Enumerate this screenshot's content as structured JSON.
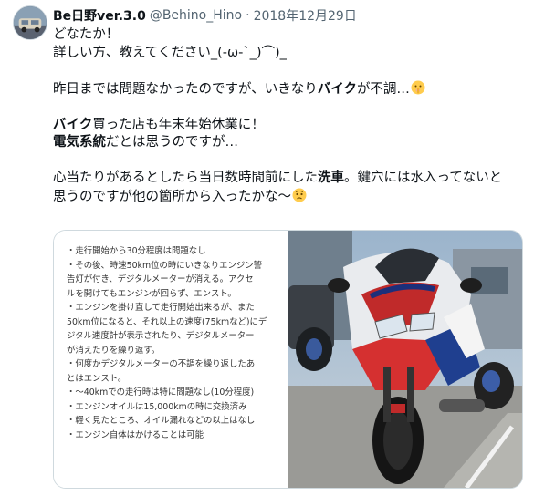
{
  "author": {
    "name": "Be日野ver.3.0",
    "handle": "@Behino_Hino",
    "separator": "·",
    "date": "2018年12月29日"
  },
  "tweet": {
    "line1": "どなたか！",
    "line2": "詳しい方、教えてください_(-ω-`_)⌒)_",
    "line3_a": "昨日までは問題なかったのですが、いきなり",
    "line3_b": "バイク",
    "line3_c": "が不調…",
    "line4_a": "バイク",
    "line4_b": "買った店も年末年始休業に！",
    "line5_a": "電気系統",
    "line5_b": "だとは思うのですが…",
    "line6_a": "心当たりがあるとしたら当日数時間前にした",
    "line6_b": "洗車",
    "line6_c": "。鍵穴には水入ってないと",
    "line7": "思うのですが他の箇所から入ったかな〜"
  },
  "emojis": {
    "e1": "shushing-face-emoji",
    "e2": "worried-face-emoji"
  },
  "notes": [
    "・走行開始から30分程度は問題なし",
    "・その後、時速50km位の時にいきなりエンジン警",
    "告灯が付き、デジタルメーターが消える。アクセ",
    "ルを開けてもエンジンが回らず、エンスト。",
    "・エンジンを掛け直して走行開始出来るが、また",
    "50km位になると、それ以上の速度(75kmなど)にデ",
    "ジタル速度計が表示されたり、デジタルメーター",
    "が消えたりを繰り返す。",
    "・何度かデジタルメーターの不調を繰り返したあ",
    "とはエンスト。",
    "・〜40kmでの走行時は特に問題なし(10分程度)",
    "・エンジンオイルは15,000kmの時に交換済み",
    "・軽く見たところ、オイル漏れなどの以上はなし",
    "・エンジン自体はかけることは可能"
  ],
  "colors": {
    "text": "#0f1419",
    "muted": "#536471",
    "border": "#cfd9de"
  }
}
